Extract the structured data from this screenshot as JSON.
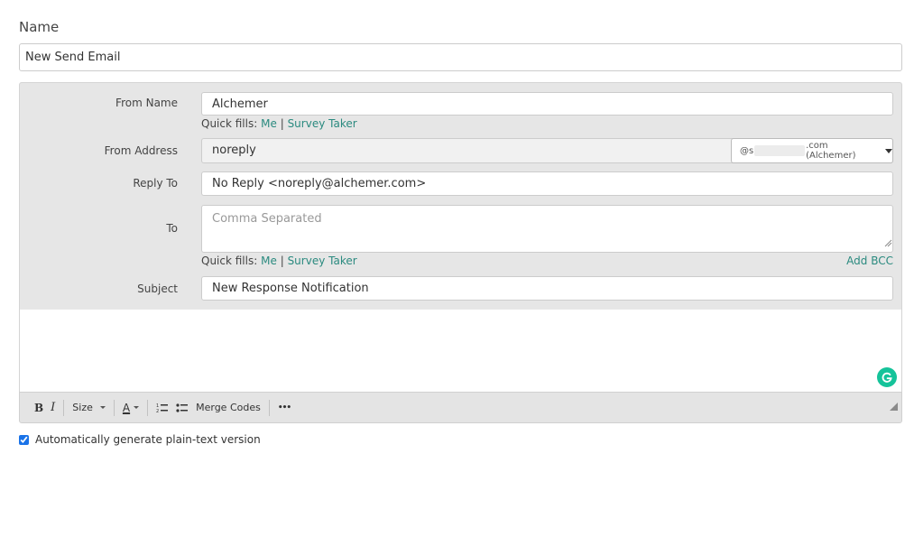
{
  "name_section": {
    "label": "Name",
    "value": "New Send Email"
  },
  "from_name": {
    "label": "From Name",
    "value": "Alchemer"
  },
  "quick_fills": {
    "label": "Quick fills:",
    "me": "Me",
    "separator": "|",
    "survey_taker": "Survey Taker"
  },
  "from_address": {
    "label": "From Address",
    "value": "noreply",
    "domain_prefix": "@s",
    "domain_suffix": ".com (Alchemer)"
  },
  "reply_to": {
    "label": "Reply To",
    "value": "No Reply <noreply@alchemer.com>"
  },
  "to": {
    "label": "To",
    "value": "",
    "placeholder": "Comma Separated",
    "add_bcc": "Add BCC"
  },
  "subject": {
    "label": "Subject",
    "value": "New Response Notification"
  },
  "toolbar": {
    "bold": "B",
    "italic": "I",
    "size": "Size",
    "font_color": "A",
    "merge_codes": "Merge Codes",
    "more": "•••"
  },
  "plain_text": {
    "label": "Automatically generate plain-text version",
    "checked": true
  },
  "colors": {
    "link": "#2a8a7f",
    "grammarly": "#15c39a",
    "panel": "#e6e6e6"
  }
}
